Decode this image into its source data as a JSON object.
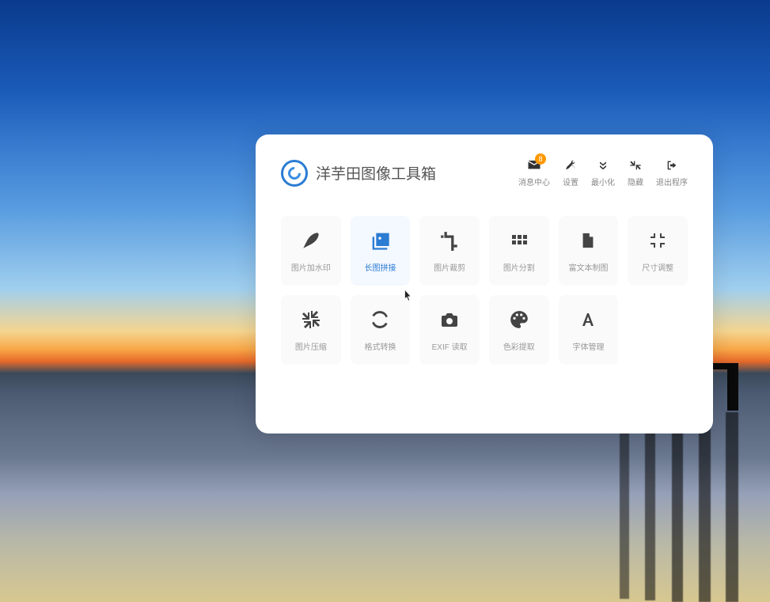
{
  "app": {
    "title": "洋芋田图像工具箱"
  },
  "topnav": {
    "notification": {
      "label": "消息中心",
      "badge": "8"
    },
    "settings": {
      "label": "设置"
    },
    "minimize": {
      "label": "最小化"
    },
    "hide": {
      "label": "隐藏"
    },
    "exit": {
      "label": "退出程序"
    }
  },
  "tools": {
    "watermark": {
      "label": "图片加水印"
    },
    "longsplice": {
      "label": "长图拼接"
    },
    "crop": {
      "label": "图片裁剪"
    },
    "split": {
      "label": "图片分割"
    },
    "richtext": {
      "label": "富文本制图"
    },
    "resize": {
      "label": "尺寸调整"
    },
    "compress": {
      "label": "图片压缩"
    },
    "convert": {
      "label": "格式转换"
    },
    "exif": {
      "label": "EXIF 读取"
    },
    "colorpick": {
      "label": "色彩提取"
    },
    "font": {
      "label": "字体管理"
    }
  }
}
